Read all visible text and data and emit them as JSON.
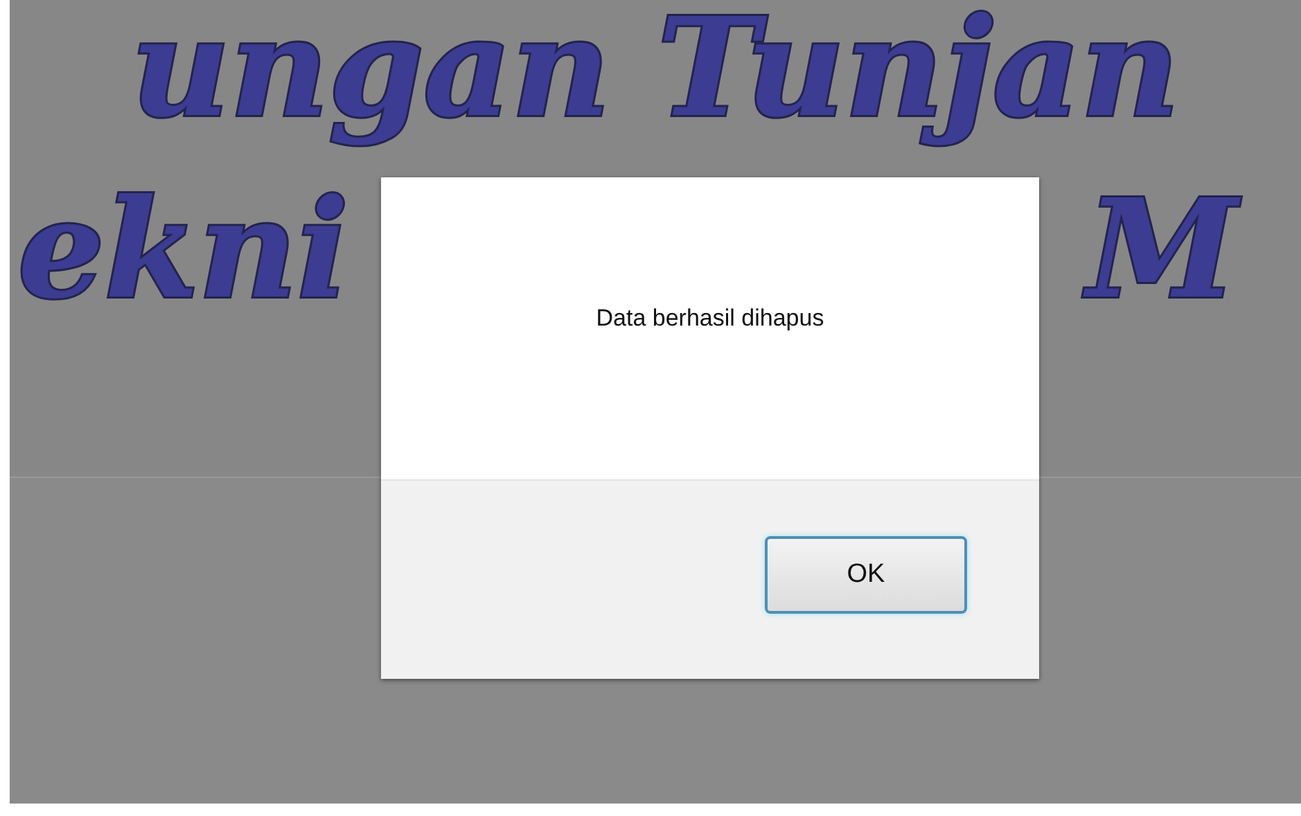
{
  "page_title": {
    "line_1": "ungan Tunjan",
    "line_2_left": "ekni",
    "line_2_right": "M"
  },
  "dialog": {
    "message": "Data berhasil dihapus",
    "buttons": [
      {
        "label": "OK",
        "focused": true
      }
    ]
  }
}
